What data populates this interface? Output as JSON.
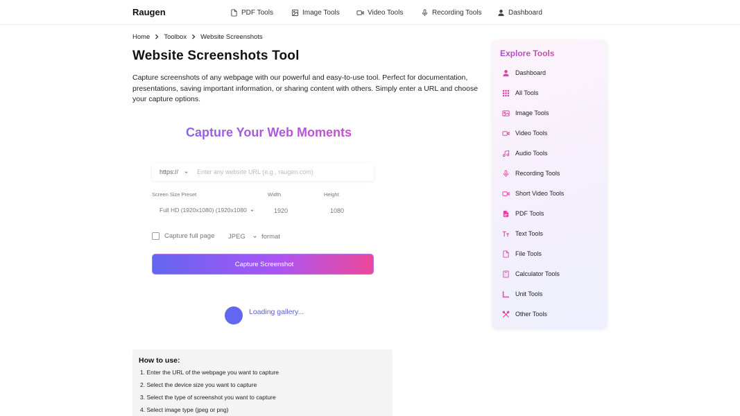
{
  "brand": "Raugen",
  "nav": [
    {
      "label": "PDF Tools",
      "icon": "file-icon"
    },
    {
      "label": "Image Tools",
      "icon": "image-icon"
    },
    {
      "label": "Video Tools",
      "icon": "video-icon"
    },
    {
      "label": "Recording Tools",
      "icon": "microphone-icon"
    },
    {
      "label": "Dashboard",
      "icon": "user-icon"
    }
  ],
  "breadcrumb": [
    "Home",
    "Toolbox",
    "Website Screenshots"
  ],
  "page_title": "Website Screenshots Tool",
  "description": "Capture screenshots of any webpage with our powerful and easy-to-use tool. Perfect for documentation, presentations, saving important information, or sharing content with others. Simply enter a URL and choose your capture options.",
  "hero": {
    "icon_glyph": "",
    "text": "Capture Your Web Moments"
  },
  "form": {
    "protocol": "https://",
    "url_placeholder": "Enter any website URL (e.g., raugen.com)",
    "preset_label": "Screen Size Preset",
    "preset_value": "Full HD (1920x1080) (1920x1080)",
    "width_label": "Width",
    "width_value": "1920",
    "height_label": "Height",
    "height_value": "1080",
    "full_page_label": "Capture full page",
    "format_value": "JPEG",
    "format_label": "format",
    "capture_glyph": "",
    "capture_label": "Capture Screenshot"
  },
  "gallery_loading": "Loading gallery...",
  "howto": {
    "title": "How to use:",
    "steps": [
      "1.  Enter the URL of the webpage you want to capture",
      "2.  Select the device size you want to capture",
      "3.  Select the type of screenshot you want to capture",
      "4.  Select image type (jpeg or png)"
    ]
  },
  "sidebar": {
    "title": "Explore Tools",
    "items": [
      {
        "label": "Dashboard",
        "icon": "user-icon"
      },
      {
        "label": "All Tools",
        "icon": "grid-icon"
      },
      {
        "label": "Image Tools",
        "icon": "image-icon"
      },
      {
        "label": "Video Tools",
        "icon": "video-icon"
      },
      {
        "label": "Audio Tools",
        "icon": "music-icon"
      },
      {
        "label": "Recording Tools",
        "icon": "microphone-icon"
      },
      {
        "label": "Short Video Tools",
        "icon": "video-icon"
      },
      {
        "label": "PDF Tools",
        "icon": "pdf-icon"
      },
      {
        "label": "Text Tools",
        "icon": "text-icon"
      },
      {
        "label": "File Tools",
        "icon": "file-icon"
      },
      {
        "label": "Calculator Tools",
        "icon": "calculator-icon"
      },
      {
        "label": "Unit Tools",
        "icon": "ruler-icon"
      },
      {
        "label": "Other Tools",
        "icon": "tools-icon"
      }
    ]
  },
  "colors": {
    "accent": "#d946a8",
    "brand_blue": "#6366f1",
    "gradient_end": "#ec4899"
  }
}
